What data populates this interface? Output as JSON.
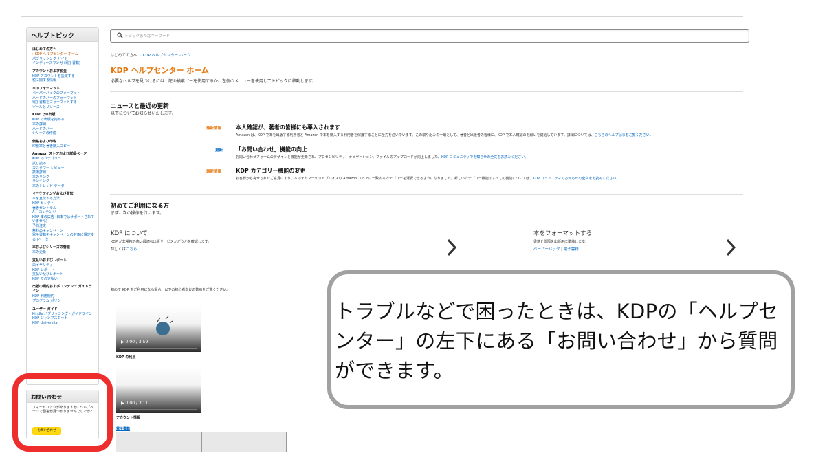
{
  "sidebar": {
    "title": "ヘルプトピック",
    "sections": [
      {
        "title": "はじめての方へ",
        "items": [
          {
            "label": "› KDP ヘルプセンター ホーム",
            "current": true
          },
          {
            "label": "パブリッシング ガイド"
          },
          {
            "label": "インディーズマンガ (電子書籍)"
          }
        ]
      },
      {
        "title": "アカウントおよび税金",
        "items": [
          {
            "label": "KDP アカウントを設定する"
          },
          {
            "label": "税に関する情報"
          }
        ]
      },
      {
        "title": "本のフォーマット",
        "items": [
          {
            "label": "ペーパーバックのフォーマット"
          },
          {
            "label": "ハードカバーのフォーマット"
          },
          {
            "label": "電子書籍をフォーマットする"
          },
          {
            "label": "ツールとリソース"
          }
        ]
      },
      {
        "title": "KDP での出版",
        "items": [
          {
            "label": "KDP で出版を始める"
          },
          {
            "label": "本の詳細"
          },
          {
            "label": "ハードカバー"
          },
          {
            "label": "シリーズの作成"
          }
        ]
      },
      {
        "title": "価格および印税",
        "items": [
          {
            "label": "印税率と著者購入コピー"
          }
        ]
      },
      {
        "title": "Amazon ストアおよび詳細ページ",
        "items": [
          {
            "label": "KDP のカテゴリー"
          },
          {
            "label": "試し読み"
          },
          {
            "label": "カスタマー レビュー"
          },
          {
            "label": "技術詳細"
          },
          {
            "label": "本のリンク"
          },
          {
            "label": "ランキング"
          },
          {
            "label": "本のトレンド データ"
          }
        ]
      },
      {
        "title": "マーケティングおよび宣伝",
        "items": [
          {
            "label": "本を宣伝する方法"
          },
          {
            "label": "KDP セレクト"
          },
          {
            "label": "著者セントラル"
          },
          {
            "label": "A+ コンテンツ"
          },
          {
            "label": "KDP 本の広告 (日本ではサポートされていません)"
          },
          {
            "label": "予約注文"
          },
          {
            "label": "無料のキャンペーン"
          },
          {
            "label": "電子書籍をキャンペーンの対象に設定する (ベータ)"
          }
        ]
      },
      {
        "title": "本およびシリーズの管理",
        "items": [
          {
            "label": "本の更新"
          }
        ]
      },
      {
        "title": "支払いおよびレポート",
        "items": [
          {
            "label": "ロイヤリティ"
          },
          {
            "label": "KDP レポート"
          },
          {
            "label": "支払い及びレポート"
          },
          {
            "label": "KDP での支払い"
          }
        ]
      },
      {
        "title": "出版の規約およびコンテンツ ガイドライン",
        "items": [
          {
            "label": "KDP 利用規約"
          },
          {
            "label": "プログラム ポリシー"
          }
        ]
      },
      {
        "title": "ユーザー ガイド",
        "items": [
          {
            "label": "Kindle パブリッシング・ガイドライン"
          },
          {
            "label": "KDP ジャンプスタート"
          },
          {
            "label": "KDP University"
          }
        ]
      }
    ]
  },
  "contact": {
    "title": "お問い合わせ",
    "text": "フィードバックがありますか? ヘルプページで回答が見つかりませんでしたか?",
    "button": "お問い合わせ"
  },
  "search": {
    "placeholder": "トピックまたはキーワード"
  },
  "breadcrumb": {
    "home": "はじめての方へ",
    "sep": "›",
    "current": "KDP ヘルプセンター ホーム"
  },
  "page": {
    "title": "KDP ヘルプセンター ホーム",
    "description": "必要なヘルプを見つけるには上記の検索バーを使用するか、左側のメニューを使用してトピックに移動します。"
  },
  "news": {
    "title": "ニュースと最近の更新",
    "subtitle": "以下についてお知らせいたします。",
    "items": [
      {
        "tag": "最新情報",
        "title": "本人確認が、著者の皆様にも導入されます",
        "text": "Amazon は、KDP で本を出版する利用者と Amazon で本を購入する利用者を保護することに全力を注いでいます。この取り組みの一環として、著者と出版者の皆様に、KDP で本人確認のお願いを開始しています。詳細については、",
        "link": "こちらのヘルプ記事をご覧ください。"
      },
      {
        "tag": "更新",
        "title": "「お問い合わせ」機能の向上",
        "text": "お問い合わせフォームのデザインと機能が更新され、アクセシビリティ、ナビゲーション、ファイルのアップロードが向上しました。",
        "link": "KDP コミュニティでお知らせの全文をお読みください。"
      },
      {
        "tag": "最新情報",
        "title": "KDP カテゴリー機能の変更",
        "text": "お客様から寄せられたご意見により、本のまたマーケットプレイスの Amazon ストアに一致するカテゴリーを選択できるようになりました。新しいカテゴリー機能のすべての機能については、",
        "link": "KDP コミュニティでお知らせの全文をお読みください。"
      }
    ]
  },
  "start": {
    "title": "初めてご利用になる方",
    "subtitle": "まず、次の操作を行います。",
    "cards": [
      {
        "title": "KDP について",
        "desc": "KDP が非常権の高い最適な出版サービスかどうかを確認します。",
        "link_prefix": "詳しくは",
        "link": "こちら"
      },
      {
        "title": "本をフォーマットする",
        "desc": "書籍と間隔を出版用に準備します。",
        "link": "ペーパーバック",
        "link_sep": " | ",
        "link2": "電子書籍"
      }
    ]
  },
  "videos": {
    "intro": "初めて KDP をご利用になる場合、以下の初心者向けの動画をご覧ください。",
    "items": [
      {
        "time": "0:00 / 3:59",
        "caption": "KDP の利点"
      },
      {
        "time": "0:00 / 3:11",
        "caption": "アカウント情報"
      }
    ],
    "ebook_caption": "電子書籍"
  },
  "callout": {
    "text": "トラブルなどで困ったときは、KDPの「ヘルプセンター」の左下にある「お問い合わせ」から質問ができます。"
  },
  "colors": {
    "accent_orange": "#e47911",
    "link_blue": "#0066c0",
    "highlight_red": "#ee2d2d",
    "button_yellow": "#ffd814"
  }
}
